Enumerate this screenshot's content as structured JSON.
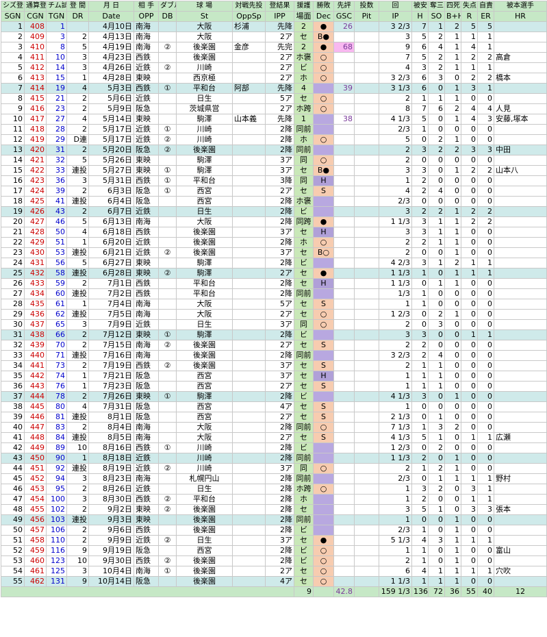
{
  "header_jp": [
    "シズ登",
    "通算登",
    "チム試",
    "登 間",
    "月 日",
    "相 手",
    "ダブル",
    "球 場",
    "対戦先投",
    "登結果",
    "援護",
    "勝敗",
    "先評",
    "投数",
    "回",
    "被安",
    "奪三",
    "四死",
    "失点",
    "自責",
    "被本選手"
  ],
  "header_en": [
    "SGN",
    "CGN",
    "TGN",
    "DR",
    "Date",
    "OPP",
    "DB",
    "St",
    "OppSp",
    "IPP",
    "場面",
    "Dec",
    "GSC",
    "Pit",
    "IP",
    "H",
    "SO",
    "B+H",
    "R",
    "ER",
    "HR"
  ],
  "rows": [
    [
      "1",
      "408",
      "1",
      "",
      "4月10日",
      "南海",
      "",
      "大阪",
      "杉浦",
      "先降",
      "2",
      "●",
      "26",
      "",
      "3 2/3",
      "7",
      "1",
      "2",
      "5",
      "5",
      ""
    ],
    [
      "2",
      "409",
      "3",
      "2",
      "4月13日",
      "南海",
      "",
      "大阪",
      "",
      "2ア",
      "セ",
      "B●",
      "",
      "",
      "3",
      "5",
      "2",
      "1",
      "1",
      "1",
      ""
    ],
    [
      "3",
      "410",
      "8",
      "5",
      "4月19日",
      "南海",
      "②",
      "後楽園",
      "金彦",
      "先完",
      "2",
      "●",
      "68",
      "",
      "9",
      "6",
      "4",
      "1",
      "4",
      "1",
      ""
    ],
    [
      "4",
      "411",
      "10",
      "3",
      "4月23日",
      "西鉄",
      "",
      "後楽園",
      "",
      "2ア",
      "ホ褒",
      "○",
      "",
      "",
      "7",
      "5",
      "2",
      "1",
      "2",
      "2",
      "高倉"
    ],
    [
      "5",
      "412",
      "14",
      "3",
      "4月26日",
      "近鉄",
      "②",
      "川崎",
      "",
      "2ア",
      "ビ",
      "○",
      "",
      "",
      "4",
      "3",
      "2",
      "1",
      "1",
      "1",
      ""
    ],
    [
      "6",
      "413",
      "15",
      "1",
      "4月28日",
      "東映",
      "",
      "西京極",
      "",
      "2ア",
      "ホ",
      "○",
      "",
      "",
      "3 2/3",
      "6",
      "3",
      "0",
      "2",
      "2",
      "橋本"
    ],
    [
      "7",
      "414",
      "19",
      "4",
      "5月3日",
      "西鉄",
      "①",
      "平和台",
      "阿部",
      "先降",
      "4",
      "",
      "39",
      "",
      "3 1/3",
      "6",
      "0",
      "1",
      "3",
      "1",
      ""
    ],
    [
      "8",
      "415",
      "21",
      "2",
      "5月6日",
      "近鉄",
      "",
      "日生",
      "",
      "5ア",
      "セ",
      "○",
      "",
      "",
      "2",
      "1",
      "1",
      "1",
      "0",
      "0",
      ""
    ],
    [
      "9",
      "416",
      "23",
      "2",
      "5月9日",
      "阪急",
      "",
      "茨城県営",
      "",
      "2ア",
      "ホ跨",
      "○",
      "",
      "",
      "8",
      "7",
      "6",
      "2",
      "4",
      "4",
      "人見"
    ],
    [
      "10",
      "417",
      "27",
      "4",
      "5月14日",
      "東映",
      "",
      "駒澤",
      "山本義",
      "先降",
      "1",
      "",
      "38",
      "",
      "4 1/3",
      "5",
      "0",
      "1",
      "4",
      "3",
      "安藤,塚本"
    ],
    [
      "11",
      "418",
      "28",
      "2",
      "5月17日",
      "近鉄",
      "①",
      "川崎",
      "",
      "2降",
      "同前",
      "",
      "",
      "",
      "2/3",
      "1",
      "0",
      "0",
      "0",
      "0",
      ""
    ],
    [
      "12",
      "419",
      "29",
      "D連",
      "5月17日",
      "近鉄",
      "②",
      "川崎",
      "",
      "2降",
      "ホ",
      "○",
      "",
      "",
      "5",
      "0",
      "2",
      "1",
      "0",
      "0",
      ""
    ],
    [
      "13",
      "420",
      "31",
      "2",
      "5月20日",
      "阪急",
      "②",
      "後楽園",
      "",
      "2降",
      "同前",
      "",
      "",
      "",
      "2",
      "3",
      "2",
      "2",
      "3",
      "3",
      "中田"
    ],
    [
      "14",
      "421",
      "32",
      "5",
      "5月26日",
      "東映",
      "",
      "駒澤",
      "",
      "3ア",
      "同",
      "○",
      "",
      "",
      "2",
      "0",
      "0",
      "0",
      "0",
      "0",
      ""
    ],
    [
      "15",
      "422",
      "33",
      "連投",
      "5月27日",
      "東映",
      "①",
      "駒澤",
      "",
      "3ア",
      "セ",
      "B●",
      "",
      "",
      "3",
      "3",
      "0",
      "1",
      "2",
      "2",
      "山本八"
    ],
    [
      "16",
      "423",
      "36",
      "3",
      "5月31日",
      "西鉄",
      "①",
      "平和台",
      "",
      "3降",
      "同",
      "H",
      "",
      "",
      "1",
      "2",
      "0",
      "0",
      "0",
      "0",
      ""
    ],
    [
      "17",
      "424",
      "39",
      "2",
      "6月3日",
      "阪急",
      "①",
      "西宮",
      "",
      "2ア",
      "セ",
      "S",
      "",
      "",
      "4",
      "2",
      "4",
      "0",
      "0",
      "0",
      ""
    ],
    [
      "18",
      "425",
      "41",
      "連投",
      "6月4日",
      "阪急",
      "",
      "西宮",
      "",
      "2降",
      "ホ褒",
      "",
      "",
      "",
      "2/3",
      "0",
      "0",
      "0",
      "0",
      "0",
      ""
    ],
    [
      "19",
      "426",
      "43",
      "2",
      "6月7日",
      "近鉄",
      "",
      "日生",
      "",
      "2降",
      "ビ",
      "",
      "",
      "",
      "3",
      "2",
      "2",
      "1",
      "2",
      "2",
      ""
    ],
    [
      "20",
      "427",
      "46",
      "5",
      "6月13日",
      "南海",
      "",
      "大阪",
      "",
      "2降",
      "同跨",
      "●",
      "",
      "",
      "1 1/3",
      "3",
      "1",
      "1",
      "2",
      "2",
      ""
    ],
    [
      "21",
      "428",
      "50",
      "4",
      "6月18日",
      "西鉄",
      "",
      "後楽園",
      "",
      "3ア",
      "セ",
      "H",
      "",
      "",
      "3",
      "3",
      "1",
      "1",
      "0",
      "0",
      ""
    ],
    [
      "22",
      "429",
      "51",
      "1",
      "6月20日",
      "近鉄",
      "",
      "後楽園",
      "",
      "2降",
      "ホ",
      "○",
      "",
      "",
      "2",
      "2",
      "1",
      "1",
      "0",
      "0",
      ""
    ],
    [
      "23",
      "430",
      "53",
      "連投",
      "6月21日",
      "近鉄",
      "②",
      "後楽園",
      "",
      "3ア",
      "セ",
      "B○",
      "",
      "",
      "2",
      "0",
      "0",
      "1",
      "0",
      "0",
      ""
    ],
    [
      "24",
      "431",
      "56",
      "5",
      "6月27日",
      "東映",
      "",
      "駒澤",
      "",
      "2降",
      "ビ",
      "",
      "",
      "",
      "4 2/3",
      "3",
      "1",
      "2",
      "1",
      "1",
      ""
    ],
    [
      "25",
      "432",
      "58",
      "連投",
      "6月28日",
      "東映",
      "②",
      "駒澤",
      "",
      "2ア",
      "セ",
      "●",
      "",
      "",
      "1 1/3",
      "1",
      "0",
      "1",
      "1",
      "1",
      ""
    ],
    [
      "26",
      "433",
      "59",
      "2",
      "7月1日",
      "西鉄",
      "",
      "平和台",
      "",
      "2降",
      "セ",
      "H",
      "",
      "",
      "1 1/3",
      "0",
      "1",
      "1",
      "0",
      "0",
      ""
    ],
    [
      "27",
      "434",
      "60",
      "連投",
      "7月2日",
      "西鉄",
      "",
      "平和台",
      "",
      "2降",
      "同前",
      "",
      "",
      "",
      "1/3",
      "1",
      "0",
      "0",
      "0",
      "0",
      ""
    ],
    [
      "28",
      "435",
      "61",
      "1",
      "7月4日",
      "南海",
      "",
      "大阪",
      "",
      "5ア",
      "セ",
      "S",
      "",
      "",
      "1",
      "1",
      "0",
      "0",
      "0",
      "0",
      ""
    ],
    [
      "29",
      "436",
      "62",
      "連投",
      "7月5日",
      "南海",
      "",
      "大阪",
      "",
      "2ア",
      "セ",
      "○",
      "",
      "",
      "1 2/3",
      "0",
      "2",
      "1",
      "0",
      "0",
      ""
    ],
    [
      "30",
      "437",
      "65",
      "3",
      "7月9日",
      "近鉄",
      "",
      "日生",
      "",
      "3ア",
      "同",
      "○",
      "",
      "",
      "2",
      "0",
      "3",
      "0",
      "0",
      "0",
      ""
    ],
    [
      "31",
      "438",
      "66",
      "2",
      "7月12日",
      "東映",
      "①",
      "駒澤",
      "",
      "2降",
      "ビ",
      "",
      "",
      "",
      "3",
      "3",
      "0",
      "0",
      "1",
      "1",
      ""
    ],
    [
      "32",
      "439",
      "70",
      "2",
      "7月15日",
      "南海",
      "②",
      "後楽園",
      "",
      "2ア",
      "セ",
      "S",
      "",
      "",
      "2",
      "2",
      "0",
      "0",
      "0",
      "0",
      ""
    ],
    [
      "33",
      "440",
      "71",
      "連投",
      "7月16日",
      "南海",
      "",
      "後楽園",
      "",
      "2降",
      "同前",
      "",
      "",
      "",
      "3 2/3",
      "2",
      "4",
      "0",
      "0",
      "0",
      ""
    ],
    [
      "34",
      "441",
      "73",
      "2",
      "7月19日",
      "西鉄",
      "②",
      "後楽園",
      "",
      "3ア",
      "セ",
      "S",
      "",
      "",
      "2",
      "1",
      "1",
      "0",
      "0",
      "0",
      ""
    ],
    [
      "35",
      "442",
      "74",
      "1",
      "7月21日",
      "阪急",
      "",
      "西宮",
      "",
      "3ア",
      "セ",
      "H",
      "",
      "",
      "1",
      "1",
      "1",
      "0",
      "0",
      "0",
      ""
    ],
    [
      "36",
      "443",
      "76",
      "1",
      "7月23日",
      "阪急",
      "",
      "西宮",
      "",
      "2ア",
      "セ",
      "S",
      "",
      "",
      "1",
      "1",
      "1",
      "0",
      "0",
      "0",
      ""
    ],
    [
      "37",
      "444",
      "78",
      "2",
      "7月26日",
      "東映",
      "①",
      "駒澤",
      "",
      "2降",
      "ビ",
      "",
      "",
      "",
      "4 1/3",
      "3",
      "0",
      "1",
      "0",
      "0",
      ""
    ],
    [
      "38",
      "445",
      "80",
      "4",
      "7月31日",
      "阪急",
      "",
      "西宮",
      "",
      "4ア",
      "セ",
      "S",
      "",
      "",
      "1",
      "0",
      "0",
      "0",
      "0",
      "0",
      ""
    ],
    [
      "39",
      "446",
      "81",
      "連投",
      "8月1日",
      "阪急",
      "",
      "西宮",
      "",
      "2ア",
      "セ",
      "S",
      "",
      "",
      "2 1/3",
      "0",
      "1",
      "0",
      "0",
      "0",
      ""
    ],
    [
      "40",
      "447",
      "83",
      "2",
      "8月4日",
      "南海",
      "",
      "大阪",
      "",
      "2降",
      "同前",
      "○",
      "",
      "",
      "7 1/3",
      "1",
      "3",
      "2",
      "0",
      "0",
      ""
    ],
    [
      "41",
      "448",
      "84",
      "連投",
      "8月5日",
      "南海",
      "",
      "大阪",
      "",
      "2ア",
      "セ",
      "S",
      "",
      "",
      "4 1/3",
      "5",
      "1",
      "0",
      "1",
      "1",
      "広瀬"
    ],
    [
      "42",
      "449",
      "89",
      "10",
      "8月16日",
      "西鉄",
      "①",
      "川崎",
      "",
      "2降",
      "ビ",
      "",
      "",
      "",
      "1 2/3",
      "0",
      "2",
      "0",
      "0",
      "0",
      ""
    ],
    [
      "43",
      "450",
      "90",
      "1",
      "8月18日",
      "近鉄",
      "",
      "川崎",
      "",
      "2降",
      "同前",
      "",
      "",
      "",
      "1 1/3",
      "2",
      "0",
      "1",
      "0",
      "0",
      ""
    ],
    [
      "44",
      "451",
      "92",
      "連投",
      "8月19日",
      "近鉄",
      "②",
      "川崎",
      "",
      "3ア",
      "同",
      "○",
      "",
      "",
      "2",
      "1",
      "2",
      "1",
      "0",
      "0",
      ""
    ],
    [
      "45",
      "452",
      "94",
      "3",
      "8月23日",
      "南海",
      "",
      "札幌円山",
      "",
      "2降",
      "同前",
      "",
      "",
      "",
      "2/3",
      "0",
      "1",
      "1",
      "1",
      "1",
      "野村"
    ],
    [
      "46",
      "453",
      "95",
      "2",
      "8月26日",
      "近鉄",
      "",
      "日生",
      "",
      "2降",
      "ホ跨",
      "○",
      "",
      "",
      "1",
      "3",
      "2",
      "0",
      "3",
      "1",
      ""
    ],
    [
      "47",
      "454",
      "100",
      "3",
      "8月30日",
      "西鉄",
      "②",
      "平和台",
      "",
      "2降",
      "ホ",
      "",
      "",
      "",
      "1",
      "2",
      "0",
      "0",
      "1",
      "1",
      ""
    ],
    [
      "48",
      "455",
      "102",
      "2",
      "9月2日",
      "東映",
      "②",
      "後楽園",
      "",
      "2降",
      "セ",
      "",
      "",
      "",
      "3",
      "5",
      "1",
      "0",
      "3",
      "3",
      "張本"
    ],
    [
      "49",
      "456",
      "103",
      "連投",
      "9月3日",
      "東映",
      "",
      "後楽園",
      "",
      "2降",
      "同前",
      "",
      "",
      "",
      "1",
      "0",
      "0",
      "1",
      "0",
      "0",
      ""
    ],
    [
      "50",
      "457",
      "106",
      "2",
      "9月6日",
      "西鉄",
      "",
      "後楽園",
      "",
      "2降",
      "ビ",
      "",
      "",
      "",
      "2/3",
      "1",
      "0",
      "1",
      "0",
      "0",
      ""
    ],
    [
      "51",
      "458",
      "110",
      "2",
      "9月9日",
      "近鉄",
      "②",
      "日生",
      "",
      "3ア",
      "セ",
      "●",
      "",
      "",
      "5 1/3",
      "4",
      "3",
      "1",
      "1",
      "1",
      ""
    ],
    [
      "52",
      "459",
      "116",
      "9",
      "9月19日",
      "阪急",
      "",
      "西宮",
      "",
      "2降",
      "ビ",
      "○",
      "",
      "",
      "1",
      "1",
      "0",
      "1",
      "0",
      "0",
      "富山"
    ],
    [
      "53",
      "460",
      "123",
      "10",
      "9月30日",
      "西鉄",
      "②",
      "後楽園",
      "",
      "2降",
      "ビ",
      "○",
      "",
      "",
      "2",
      "1",
      "0",
      "1",
      "0",
      "0",
      ""
    ],
    [
      "54",
      "461",
      "125",
      "3",
      "10月4日",
      "南海",
      "①",
      "後楽園",
      "",
      "2ア",
      "セ",
      "○",
      "",
      "",
      "6",
      "4",
      "1",
      "1",
      "1",
      "1",
      "穴吹"
    ],
    [
      "55",
      "462",
      "131",
      "9",
      "10月14日",
      "阪急",
      "",
      "後楽園",
      "",
      "4ア",
      "セ",
      "○",
      "",
      "",
      "1 1/3",
      "1",
      "1",
      "1",
      "0",
      "0",
      ""
    ]
  ],
  "totals": {
    "dec": "9",
    "gsc": "42.8",
    "ip": "159 1/3",
    "h": "136",
    "so": "72",
    "bh": "36",
    "r": "55",
    "er": "40",
    "hr": "12"
  }
}
